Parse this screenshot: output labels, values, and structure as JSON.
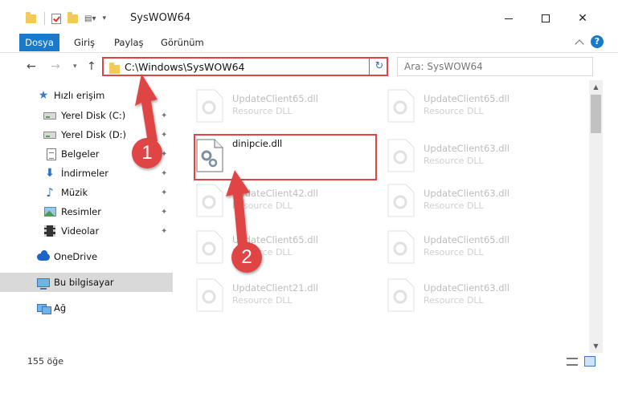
{
  "window": {
    "title": "SysWOW64",
    "minimize_icon": "minimize-icon",
    "maximize_icon": "maximize-icon",
    "close_label": "✕"
  },
  "ribbon": {
    "tabs": [
      {
        "label": "Dosya"
      },
      {
        "label": "Giriş"
      },
      {
        "label": "Paylaş"
      },
      {
        "label": "Görünüm"
      }
    ],
    "help_label": "?"
  },
  "address": {
    "path": "C:\\Windows\\SysWOW64",
    "refresh_glyph": "↻",
    "back_glyph": "←",
    "forward_glyph": "→",
    "recent_glyph": "▾",
    "up_glyph": "↑"
  },
  "search": {
    "placeholder": "Ara: SysWOW64"
  },
  "sidebar": {
    "items": [
      {
        "label": "Hızlı erişim",
        "icon": "star-icon"
      },
      {
        "label": "Yerel Disk (C:)",
        "icon": "drive-icon",
        "pinned": true
      },
      {
        "label": "Yerel Disk (D:)",
        "icon": "drive-icon",
        "pinned": true
      },
      {
        "label": "Belgeler",
        "icon": "document-icon",
        "pinned": true
      },
      {
        "label": "İndirmeler",
        "icon": "download-icon",
        "pinned": true
      },
      {
        "label": "Müzik",
        "icon": "music-icon",
        "pinned": true
      },
      {
        "label": "Resimler",
        "icon": "pictures-icon",
        "pinned": true
      },
      {
        "label": "Videolar",
        "icon": "video-icon",
        "pinned": true
      },
      {
        "label": "OneDrive",
        "icon": "cloud-icon"
      },
      {
        "label": "Bu bilgisayar",
        "icon": "computer-icon",
        "selected": true
      },
      {
        "label": "Ağ",
        "icon": "network-icon"
      }
    ],
    "pin_glyph": "📌"
  },
  "files": [
    {
      "name": "UpdateClient65.dll",
      "desc": "Resource DLL"
    },
    {
      "name": "UpdateClient65.dll",
      "desc": "Resource DLL"
    },
    {
      "name": "dinipcie.dll",
      "desc": "",
      "focused": true
    },
    {
      "name": "UpdateClient63.dll",
      "desc": "Resource DLL"
    },
    {
      "name": "UpdateClient42.dll",
      "desc": "Resource DLL"
    },
    {
      "name": "UpdateClient63.dll",
      "desc": "Resource DLL"
    },
    {
      "name": "UpdateClient65.dll",
      "desc": "Resource DLL"
    },
    {
      "name": "UpdateClient65.dll",
      "desc": "Resource DLL"
    },
    {
      "name": "UpdateClient21.dll",
      "desc": "Resource DLL"
    },
    {
      "name": "UpdateClient63.dll",
      "desc": "Resource DLL"
    }
  ],
  "scrollbar": {
    "up_glyph": "▲",
    "down_glyph": "▼"
  },
  "status": {
    "item_count": "155 öğe"
  },
  "annotations": {
    "step1": "1",
    "step2": "2"
  },
  "colors": {
    "accent": "#1979ca",
    "highlight": "#e04545",
    "selected_bg": "#d9d9d9"
  }
}
